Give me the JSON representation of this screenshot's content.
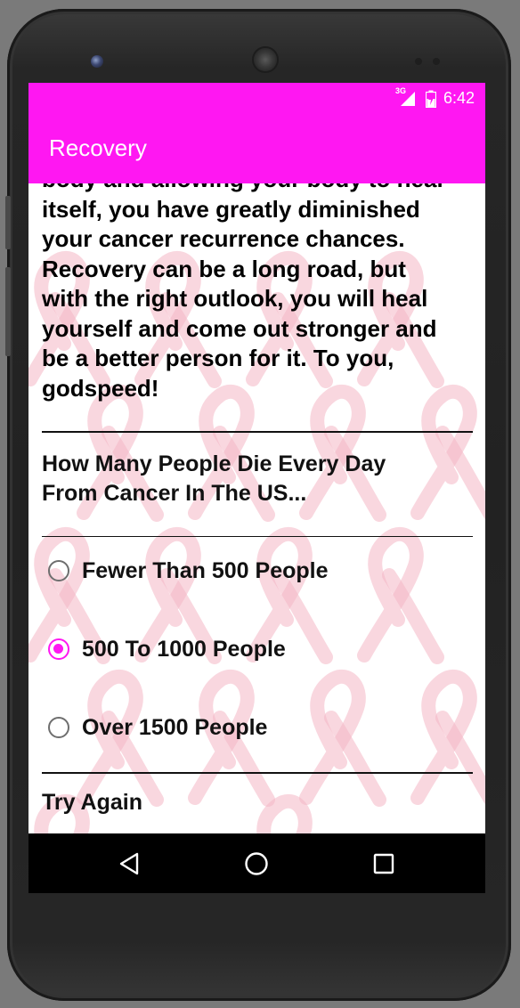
{
  "status_bar": {
    "network_label": "3G",
    "time": "6:42"
  },
  "app_bar": {
    "title": "Recovery",
    "color": "#ff17f2"
  },
  "content": {
    "paragraph_partial_top": "body and allowing your body to heal",
    "paragraph_lines": [
      "itself, you have greatly diminished",
      "your cancer recurrence chances.",
      "Recovery can be a long road, but",
      "with the right outlook, you will heal",
      "yourself and come out stronger and",
      "be a better person for it. To you,",
      "godspeed!"
    ],
    "question_lines": [
      "How Many People Die Every Day",
      "From Cancer In The US..."
    ],
    "options": [
      {
        "label": "Fewer Than 500 People",
        "selected": false
      },
      {
        "label": "500 To 1000 People",
        "selected": true
      },
      {
        "label": "Over 1500 People",
        "selected": false
      }
    ],
    "try_again": "Try Again"
  },
  "nav_bar": {
    "icons": [
      "back-icon",
      "home-icon",
      "recents-icon"
    ]
  },
  "colors": {
    "accent": "#ff17f2",
    "ribbon": "#f4b6c4"
  }
}
